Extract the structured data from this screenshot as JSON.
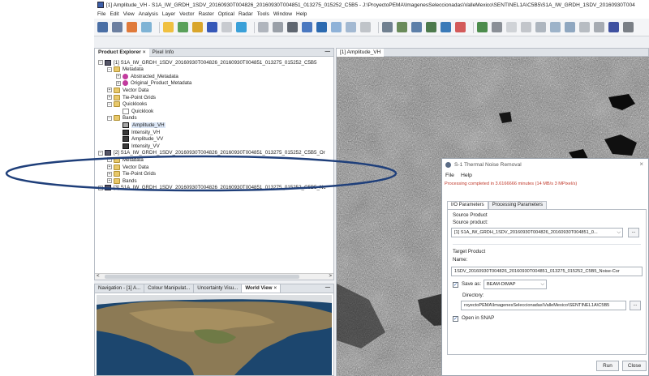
{
  "window": {
    "title": "[1] Amplitude_VH - S1A_IW_GRDH_1SDV_20160930T004826_20160930T004851_013275_015252_C5B5 - J:\\ProyectoPEMA\\ImagenesSeleccionadas\\ValleMexico\\SENTINEL1A\\C5B5\\S1A_IW_GRDH_1SDV_20160930T004"
  },
  "menu": [
    "File",
    "Edit",
    "View",
    "Analysis",
    "Layer",
    "Vector",
    "Raster",
    "Optical",
    "Radar",
    "Tools",
    "Window",
    "Help"
  ],
  "product_explorer": {
    "tabs": [
      "Product Explorer",
      "Pixel Info"
    ],
    "tab_close": "×",
    "minimize": "—",
    "rows": [
      {
        "indent": 0,
        "expander": "⊟",
        "icon": "product",
        "label": "[1] S1A_IW_GRDH_1SDV_20160930T004826_20160930T004851_013275_015252_C5B5"
      },
      {
        "indent": 1,
        "expander": "⊟",
        "icon": "folder",
        "label": "Metadata"
      },
      {
        "indent": 2,
        "expander": "⊞",
        "icon": "metadata",
        "label": "Abstracted_Metadata"
      },
      {
        "indent": 2,
        "expander": "⊞",
        "icon": "metadata",
        "label": "Original_Product_Metadata"
      },
      {
        "indent": 1,
        "expander": "⊞",
        "icon": "folder",
        "label": "Vector Data"
      },
      {
        "indent": 1,
        "expander": "⊞",
        "icon": "folder",
        "label": "Tie-Point Grids"
      },
      {
        "indent": 1,
        "expander": "⊟",
        "icon": "folder",
        "label": "Quicklooks"
      },
      {
        "indent": 2,
        "expander": "",
        "icon": "quicklook",
        "label": "Quicklook"
      },
      {
        "indent": 1,
        "expander": "⊟",
        "icon": "folder",
        "label": "Bands"
      },
      {
        "indent": 2,
        "expander": "",
        "icon": "band-selected",
        "label": "Amplitude_VH"
      },
      {
        "indent": 2,
        "expander": "",
        "icon": "band",
        "label": "Intensity_VH"
      },
      {
        "indent": 2,
        "expander": "",
        "icon": "band",
        "label": "Amplitude_VV"
      },
      {
        "indent": 2,
        "expander": "",
        "icon": "band",
        "label": "Intensity_VV"
      },
      {
        "indent": 0,
        "expander": "⊟",
        "icon": "product",
        "label": "[2] S1A_IW_GRDH_1SDV_20160930T004826_20160930T004851_013275_015252_C5B5_Or"
      },
      {
        "indent": 1,
        "expander": "⊞",
        "icon": "folder",
        "label": "Metadata"
      },
      {
        "indent": 1,
        "expander": "⊞",
        "icon": "folder",
        "label": "Vector Data"
      },
      {
        "indent": 1,
        "expander": "⊞",
        "icon": "folder",
        "label": "Tie-Point Grids"
      },
      {
        "indent": 1,
        "expander": "⊞",
        "icon": "folder",
        "label": "Bands"
      },
      {
        "indent": 0,
        "expander": "⊞",
        "icon": "product",
        "label": "[3] S1A_IW_GRDH_1SDV_20160930T004826_20160930T004851_013275_015252_C5B5_Nc"
      }
    ],
    "scroll_left": "<",
    "scroll_right": ">"
  },
  "navigation": {
    "tabs": [
      "Navigation - [1] A...",
      "Colour Manipulat...",
      "Uncertainty Visu...",
      "World View"
    ],
    "tab_close": "×",
    "minimize": "—",
    "active_tab": "World View"
  },
  "image_view": {
    "tab": "[1] Amplitude_VH"
  },
  "dialog": {
    "title": "S-1 Thermal Noise Removal",
    "close": "×",
    "menu": [
      "File",
      "Help"
    ],
    "status": "Processing completed in 3.6166666 minutes (14 MB/s 3 MPixel/s)",
    "tabs": [
      "I/O Parameters",
      "Processing Parameters"
    ],
    "source_heading": "Source Product",
    "source_label": "Source product:",
    "source_value": "[1] S1A_IW_GRDH_1SDV_20160930T004826_20160930T004851_0...",
    "target_heading": "Target Product",
    "name_label": "Name:",
    "name_value": "1SDV_20160930T004826_20160930T004851_013275_015252_C5B5_Noise-Cor",
    "save_as_label": "Save as:",
    "save_as_checked": true,
    "format_value": "BEAM-DIMAP",
    "directory_label": "Directory:",
    "directory_value": "royectoPEMA\\ImagenesSeleccionadas\\ValleMexico\\SENTINEL1A\\C5B5",
    "open_in_snap_label": "Open in SNAP",
    "open_in_snap_checked": true,
    "browse_label": "...",
    "run_label": "Run",
    "close_label": "Close"
  },
  "colors": {
    "status_red": "#c0392b",
    "annotation_oval": "#1f3f7a",
    "ocean": "#183a5c"
  }
}
